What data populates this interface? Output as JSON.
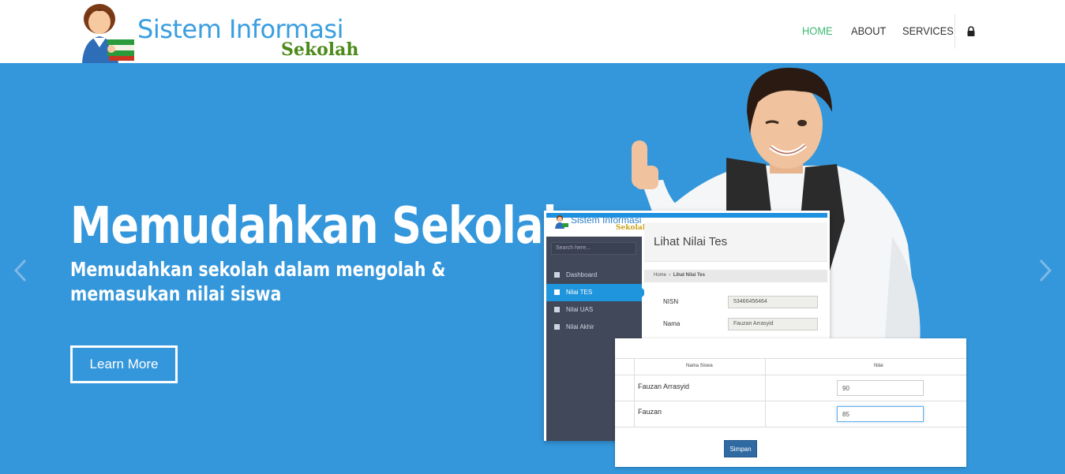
{
  "brand": {
    "title": "Sistem Informasi",
    "subtitle": "Sekolah"
  },
  "nav": {
    "items": [
      {
        "label": "HOME",
        "active": true
      },
      {
        "label": "ABOUT",
        "active": false
      },
      {
        "label": "SERVICES",
        "active": false
      }
    ],
    "lock_icon": "lock-icon"
  },
  "hero": {
    "title": "Memudahkan Sekolah",
    "subtitle": "Memudahkan sekolah dalam mengolah & memasukan nilai siswa",
    "button": "Learn More",
    "prev_icon": "chevron-left-icon",
    "next_icon": "chevron-right-icon",
    "background": "#3497db"
  },
  "mock_app": {
    "logo_title": "Sistem Informasi",
    "logo_subtitle": "Sekolah",
    "search_placeholder": "Search here...",
    "sidebar": [
      {
        "label": "Dashboard",
        "active": false
      },
      {
        "label": "Nilai TES",
        "active": true
      },
      {
        "label": "Nilai UAS",
        "active": false
      },
      {
        "label": "Nilai Akhir",
        "active": false
      }
    ],
    "page_title": "Lihat Nilai Tes",
    "breadcrumb_home": "Home",
    "breadcrumb_current": "Lihat Nilai Tes",
    "fields": [
      {
        "label": "NISN",
        "value": "53466456464"
      },
      {
        "label": "Nama",
        "value": "Fauzan Arrasyid"
      }
    ]
  },
  "score_table": {
    "headers": [
      "Nama Siswa",
      "Nilai"
    ],
    "rows": [
      {
        "name": "Fauzan Arrasyid",
        "score": "90"
      },
      {
        "name": "Fauzan",
        "score": "85"
      }
    ],
    "save_label": "Simpan"
  }
}
